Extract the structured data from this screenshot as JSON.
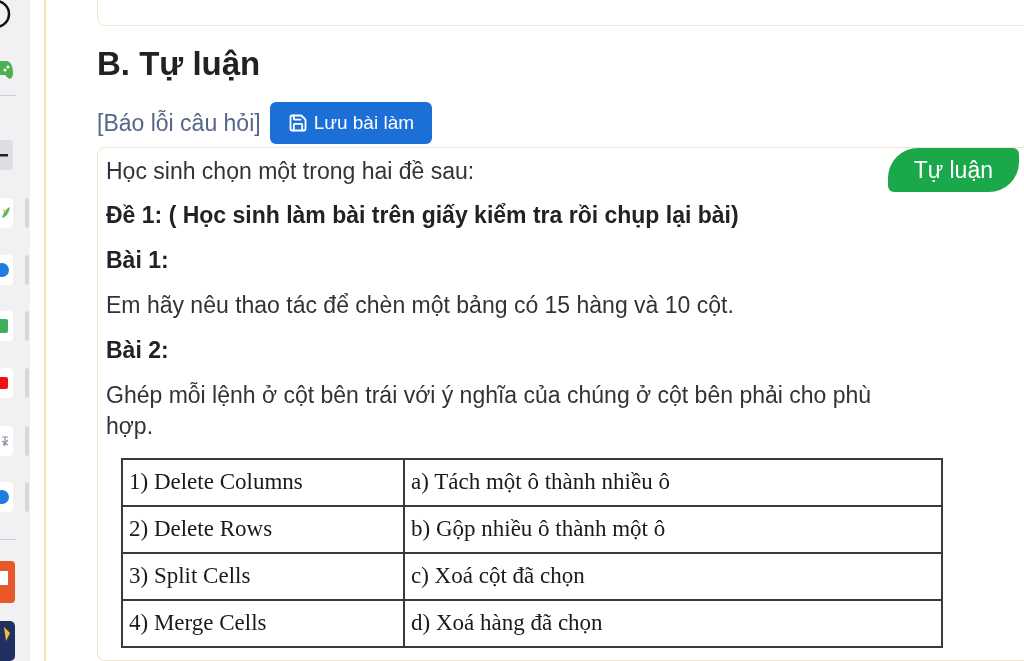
{
  "section": {
    "title": "B. Tự luận"
  },
  "report_link": "[Báo lỗi câu hỏi]",
  "save_button": {
    "label": "Lưu bài làm"
  },
  "question": {
    "intro": "Học sinh chọn một trong hai đề sau:",
    "badge": "Tự luận",
    "blocks": [
      {
        "kind": "heading",
        "text": "Đề 1: ( Học sinh làm bài trên giấy kiểm tra rồi chụp lại bài)"
      },
      {
        "kind": "heading",
        "text": "Bài 1:"
      },
      {
        "kind": "text",
        "text": "Em hãy nêu thao tác để chèn một bảng có 15 hàng và 10 cột."
      },
      {
        "kind": "heading",
        "text": "Bài 2:"
      },
      {
        "kind": "text",
        "text": "Ghép mỗi lệnh ở cột bên trái với ý nghĩa của chúng ở cột bên phải cho phù hợp."
      },
      {
        "kind": "table",
        "rows": [
          [
            "1) Delete Columns",
            "a) Tách một ô thành nhiều ô"
          ],
          [
            "2) Delete Rows",
            "b) Gộp nhiều ô thành một ô"
          ],
          [
            "3) Split Cells",
            "c) Xoá cột đã chọn"
          ],
          [
            "4) Merge Cells",
            "d) Xoá hàng đã chọn"
          ]
        ]
      }
    ]
  }
}
